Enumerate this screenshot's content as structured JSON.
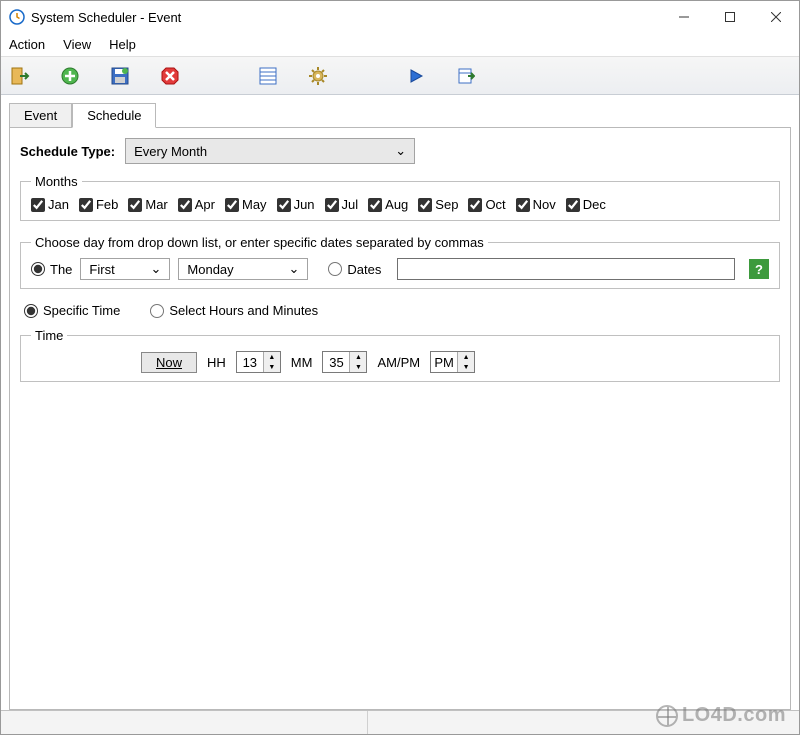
{
  "title": "System Scheduler - Event",
  "menu": {
    "action": "Action",
    "view": "View",
    "help": "Help"
  },
  "tabs": {
    "event": "Event",
    "schedule": "Schedule"
  },
  "scheduleTypeLabel": "Schedule Type:",
  "scheduleTypeValue": "Every Month",
  "months": {
    "legend": "Months",
    "items": [
      "Jan",
      "Feb",
      "Mar",
      "Apr",
      "May",
      "Jun",
      "Jul",
      "Aug",
      "Sep",
      "Oct",
      "Nov",
      "Dec"
    ]
  },
  "daySection": {
    "legend": "Choose day from drop down list, or enter specific dates separated by commas",
    "theLabel": "The",
    "ordinal": "First",
    "weekday": "Monday",
    "datesLabel": "Dates",
    "datesValue": ""
  },
  "timeMode": {
    "specific": "Specific Time",
    "selectHM": "Select Hours and Minutes"
  },
  "time": {
    "legend": "Time",
    "nowLabel": "Now",
    "hhLabel": "HH",
    "hh": "13",
    "mmLabel": "MM",
    "mm": "35",
    "ampmLabel": "AM/PM",
    "ampm": "PM"
  },
  "helpIcon": "?",
  "watermark": "LO4D.com"
}
